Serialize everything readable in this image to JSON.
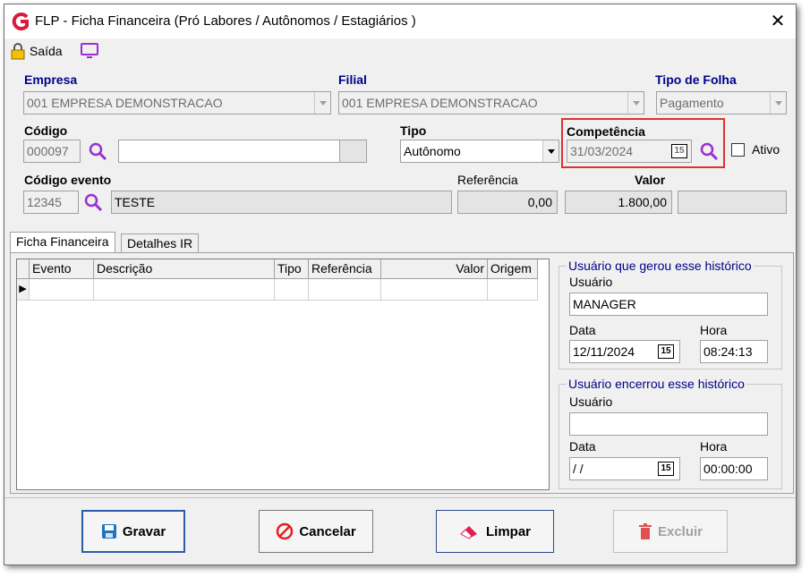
{
  "window": {
    "title": "FLP - Ficha Financeira (Pró Labores / Autônomos / Estagiários )",
    "close_glyph": "✕"
  },
  "toolbar": {
    "exit_label": "Saída"
  },
  "empresa": {
    "label": "Empresa",
    "value": "001 EMPRESA DEMONSTRACAO"
  },
  "filial": {
    "label": "Filial",
    "value": "001 EMPRESA DEMONSTRACAO"
  },
  "tipo_folha": {
    "label": "Tipo de Folha",
    "value": "Pagamento"
  },
  "codigo": {
    "label": "Código",
    "value": "000097",
    "description": ""
  },
  "tipo": {
    "label": "Tipo",
    "value": "Autônomo"
  },
  "competencia": {
    "label": "Competência",
    "value": "31/03/2024",
    "highlight_color": "#e03030"
  },
  "ativo": {
    "label": "Ativo",
    "checked": false
  },
  "codigo_evento": {
    "label": "Código evento",
    "value": "12345",
    "description": "TESTE"
  },
  "referencia": {
    "label": "Referência",
    "value": "0,00"
  },
  "valor": {
    "label": "Valor",
    "value": "1.800,00",
    "extra": ""
  },
  "tabs": [
    {
      "label": "Ficha Financeira",
      "active": true
    },
    {
      "label": "Detalhes IR",
      "active": false
    }
  ],
  "grid": {
    "columns": [
      "Evento",
      "Descrição",
      "Tipo",
      "Referência",
      "Valor",
      "Origem"
    ],
    "row_indicator": "▶"
  },
  "gerou": {
    "legend": "Usuário que gerou esse histórico",
    "usuario_label": "Usuário",
    "usuario": "MANAGER",
    "data_label": "Data",
    "data": "12/11/2024",
    "hora_label": "Hora",
    "hora": "08:24:13"
  },
  "encerrou": {
    "legend": "Usuário encerrou esse histórico",
    "usuario_label": "Usuário",
    "usuario": "",
    "data_label": "Data",
    "data": "/ /",
    "hora_label": "Hora",
    "hora": "00:00:00"
  },
  "calendar_glyph": "15",
  "buttons": {
    "gravar": "Gravar",
    "cancelar": "Cancelar",
    "limpar": "Limpar",
    "excluir": "Excluir"
  },
  "colors": {
    "accent": "#00008b",
    "brand": "#d81b3c",
    "search": "#9b30d0"
  }
}
